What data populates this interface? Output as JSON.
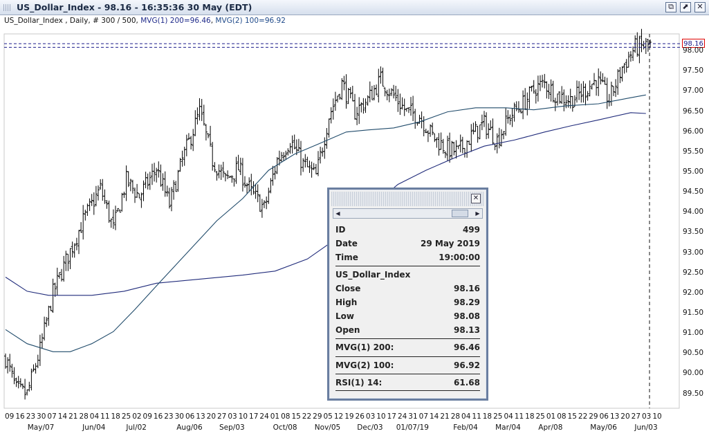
{
  "window": {
    "title": "US_Dollar_Index - 98.16 - 16:35:36  30 May (EDT)",
    "buttons": [
      "restore",
      "maximize",
      "close"
    ]
  },
  "subheader": {
    "prefix": "US_Dollar_Index , Daily, # 300 / 500, ",
    "mvg1": "MVG(1) 200=96.46",
    "sep": ", ",
    "mvg2": "MVG(2) 100=96.92"
  },
  "price_tag": "98.16",
  "colors": {
    "bars": "#000000",
    "ma200": "#1f2a7a",
    "ma100": "#1f4a6a",
    "level_line": "#1a1a8a",
    "tag_border": "#dd0000"
  },
  "chart_data": {
    "type": "ohlc",
    "title": "",
    "ylim": [
      89.2,
      98.45
    ],
    "y_ticks": [
      "98.00",
      "97.50",
      "97.00",
      "96.50",
      "96.00",
      "95.50",
      "95.00",
      "94.50",
      "94.00",
      "93.50",
      "93.00",
      "92.50",
      "92.00",
      "91.50",
      "91.00",
      "90.50",
      "90.00",
      "89.50"
    ],
    "x_day_ticks": [
      "09",
      "16",
      "23",
      "30",
      "07",
      "14",
      "21",
      "28",
      "04",
      "11",
      "18",
      "25",
      "02",
      "09",
      "16",
      "23",
      "30",
      "06",
      "13",
      "20",
      "27",
      "03",
      "10",
      "17",
      "24",
      "01",
      "08",
      "15",
      "22",
      "29",
      "05",
      "12",
      "19",
      "26",
      "03",
      "10",
      "17",
      "24",
      "31",
      "07",
      "14",
      "21",
      "28",
      "04",
      "11",
      "18",
      "25",
      "04",
      "11",
      "18",
      "25",
      "01",
      "08",
      "15",
      "22",
      "29",
      "06",
      "13",
      "20",
      "27",
      "03",
      "10"
    ],
    "x_month_ticks": [
      "May/07",
      "Jun/04",
      "Jul/02",
      "Aug/06",
      "Sep/03",
      "Oct/08",
      "Nov/05",
      "Dec/03",
      "01/07/19",
      "Feb/04",
      "Mar/04",
      "Apr/08",
      "May/06",
      "Jun/03"
    ],
    "close_path": [
      [
        0,
        90.4
      ],
      [
        5,
        89.6
      ],
      [
        10,
        89.5
      ],
      [
        16,
        90.6
      ],
      [
        22,
        92.0
      ],
      [
        28,
        92.8
      ],
      [
        36,
        93.8
      ],
      [
        44,
        94.6
      ],
      [
        50,
        93.6
      ],
      [
        56,
        94.8
      ],
      [
        62,
        94.4
      ],
      [
        70,
        95.1
      ],
      [
        76,
        94.2
      ],
      [
        82,
        95.3
      ],
      [
        90,
        96.5
      ],
      [
        96,
        95.3
      ],
      [
        102,
        94.8
      ],
      [
        108,
        95.1
      ],
      [
        114,
        94.5
      ],
      [
        120,
        94.1
      ],
      [
        126,
        95.3
      ],
      [
        132,
        95.8
      ],
      [
        138,
        95.2
      ],
      [
        144,
        94.9
      ],
      [
        150,
        96.4
      ],
      [
        156,
        97.2
      ],
      [
        162,
        96.5
      ],
      [
        168,
        96.8
      ],
      [
        174,
        97.3
      ],
      [
        180,
        96.9
      ],
      [
        186,
        96.5
      ],
      [
        192,
        96.4
      ],
      [
        198,
        95.9
      ],
      [
        204,
        95.6
      ],
      [
        210,
        95.5
      ],
      [
        216,
        95.9
      ],
      [
        222,
        96.2
      ],
      [
        228,
        95.8
      ],
      [
        234,
        96.4
      ],
      [
        240,
        96.7
      ],
      [
        246,
        97.1
      ],
      [
        250,
        97.2
      ],
      [
        256,
        96.9
      ],
      [
        262,
        96.8
      ],
      [
        268,
        97.0
      ],
      [
        274,
        97.3
      ],
      [
        280,
        96.8
      ],
      [
        286,
        97.6
      ],
      [
        292,
        98.1
      ],
      [
        300,
        98.16
      ]
    ],
    "ma200": {
      "name": "MVG(1) 200",
      "last": 96.46,
      "path": [
        [
          0,
          92.4
        ],
        [
          10,
          92.05
        ],
        [
          20,
          91.95
        ],
        [
          40,
          91.95
        ],
        [
          55,
          92.05
        ],
        [
          70,
          92.25
        ],
        [
          90,
          92.35
        ],
        [
          110,
          92.45
        ],
        [
          125,
          92.55
        ],
        [
          140,
          92.85
        ],
        [
          152,
          93.3
        ],
        [
          162,
          93.8
        ],
        [
          172,
          94.25
        ],
        [
          182,
          94.7
        ],
        [
          195,
          95.05
        ],
        [
          210,
          95.4
        ],
        [
          222,
          95.65
        ],
        [
          236,
          95.8
        ],
        [
          250,
          96.0
        ],
        [
          262,
          96.15
        ],
        [
          275,
          96.3
        ],
        [
          290,
          96.48
        ],
        [
          297,
          96.46
        ]
      ]
    },
    "ma100": {
      "name": "MVG(2) 100",
      "last": 96.92,
      "path": [
        [
          0,
          91.1
        ],
        [
          10,
          90.75
        ],
        [
          22,
          90.55
        ],
        [
          30,
          90.55
        ],
        [
          40,
          90.75
        ],
        [
          50,
          91.05
        ],
        [
          60,
          91.6
        ],
        [
          72,
          92.3
        ],
        [
          85,
          93.05
        ],
        [
          98,
          93.8
        ],
        [
          110,
          94.35
        ],
        [
          122,
          95.05
        ],
        [
          134,
          95.45
        ],
        [
          145,
          95.7
        ],
        [
          158,
          96.0
        ],
        [
          168,
          96.05
        ],
        [
          180,
          96.1
        ],
        [
          192,
          96.25
        ],
        [
          205,
          96.5
        ],
        [
          218,
          96.6
        ],
        [
          232,
          96.6
        ],
        [
          245,
          96.55
        ],
        [
          260,
          96.65
        ],
        [
          275,
          96.7
        ],
        [
          290,
          96.85
        ],
        [
          297,
          96.92
        ]
      ]
    }
  },
  "info_panel": {
    "rows_top": [
      {
        "k": "ID",
        "v": "499"
      },
      {
        "k": "Date",
        "v": "29 May 2019"
      },
      {
        "k": "Time",
        "v": "19:00:00"
      }
    ],
    "symbol": "US_Dollar_Index",
    "rows_ohlc": [
      {
        "k": "Close",
        "v": "98.16"
      },
      {
        "k": "High",
        "v": "98.29"
      },
      {
        "k": "Low",
        "v": "98.08"
      },
      {
        "k": "Open",
        "v": "98.13"
      }
    ],
    "mvg1": {
      "k": "MVG(1) 200:",
      "v": "96.46"
    },
    "mvg2": {
      "k": "MVG(2) 100:",
      "v": "96.92"
    },
    "rsi": {
      "k": "RSI(1) 14:",
      "v": "61.68"
    }
  }
}
